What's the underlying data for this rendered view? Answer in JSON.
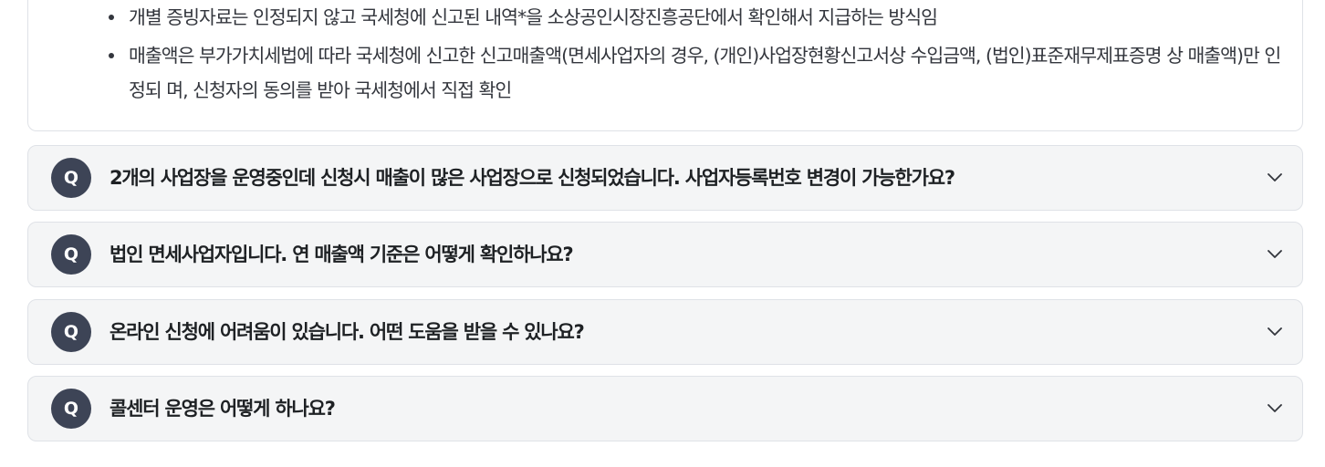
{
  "answer": {
    "bullets": [
      "개별 증빙자료는 인정되지 않고 국세청에 신고된 내역*을 소상공인시장진흥공단에서 확인해서 지급하는 방식임",
      "매출액은 부가가치세법에 따라 국세청에 신고한 신고매출액(면세사업자의 경우, (개인)사업장현황신고서상 수입금액, (법인)표준재무제표증명 상 매출액)만 인정되 며, 신청자의 동의를 받아 국세청에서 직접 확인"
    ]
  },
  "faq": [
    {
      "badge": "Q",
      "question": "2개의 사업장을 운영중인데 신청시 매출이 많은 사업장으로 신청되었습니다. 사업자등록번호 변경이 가능한가요?",
      "icon": "chevron-down-icon"
    },
    {
      "badge": "Q",
      "question": "법인 면세사업자입니다. 연 매출액 기준은 어떻게 확인하나요?",
      "icon": "chevron-down-icon"
    },
    {
      "badge": "Q",
      "question": "온라인 신청에 어려움이 있습니다. 어떤 도움을 받을 수 있나요?",
      "icon": "chevron-down-icon"
    },
    {
      "badge": "Q",
      "question": "콜센터 운영은 어떻게 하나요?",
      "icon": "chevron-down-icon"
    }
  ],
  "colors": {
    "badge": "#3d4456",
    "row_bg": "#f4f5f6",
    "border": "#dfe2e7",
    "text": "#1e2124"
  }
}
